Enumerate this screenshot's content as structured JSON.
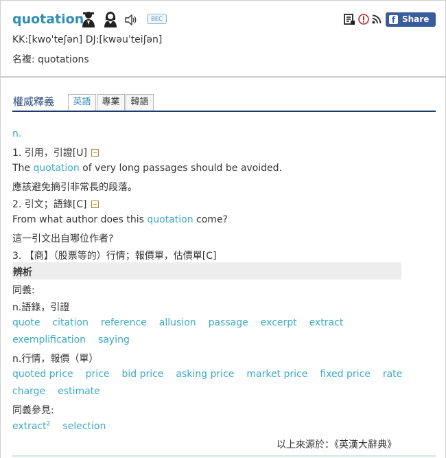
{
  "header": {
    "word": "quotation",
    "bec_badge": "BEC",
    "share_label": "Share 0",
    "phonetic": "KK:[kwoˈteʃən] DJ:[kwəuˈteiʃən]",
    "plural": "名複: quotations"
  },
  "icons": [
    "speaker-male-icon",
    "speaker-female-icon",
    "audio-icon",
    "add-to-list-icon",
    "report-icon",
    "rss-icon",
    "facebook-icon"
  ],
  "section": {
    "title": "權威釋義",
    "tabs": [
      "英語",
      "專業",
      "韓語"
    ],
    "active_tab": "英語"
  },
  "entry": {
    "pos": "n.",
    "sense1": "1. 引用，引證[U]",
    "ex1_pre": "The ",
    "ex1_link": "quotation",
    "ex1_post": " of very long passages should be avoided.",
    "ex1_zh": "應該避免摘引非常長的段落。",
    "sense2": "2. 引文；語錄[C]",
    "ex2_pre": "From what author does this ",
    "ex2_link": "quotation",
    "ex2_post": " come?",
    "ex2_zh": "這一引文出自哪位作者?",
    "sense3": "3. 【商】（股票等的）行情；報價單，估價單[C]"
  },
  "analysis": {
    "title": "辨析",
    "synonyms_label": "同義:",
    "group1_label": "n.語錄，引證",
    "group1_row1": [
      "quote",
      "citation",
      "reference",
      "allusion",
      "passage",
      "excerpt",
      "extract"
    ],
    "group1_row2": [
      "exemplification",
      "saying"
    ],
    "group2_label": "n.行情，報價（單）",
    "group2_row1": [
      "quoted price",
      "price",
      "bid price",
      "asking price",
      "market price",
      "fixed price",
      "rate"
    ],
    "group2_row2": [
      "charge",
      "estimate"
    ],
    "see_also_label": "同義參見:",
    "see_also_word": "extract",
    "see_also_sup": "2",
    "see_also_other": "selection"
  },
  "source": "以上來源於：《英漢大辭典》",
  "colors": {
    "link": "#3aa9c4",
    "word": "#2f8eb4",
    "rule": "#1f3a70",
    "share_bg": "#3b5c9c"
  }
}
